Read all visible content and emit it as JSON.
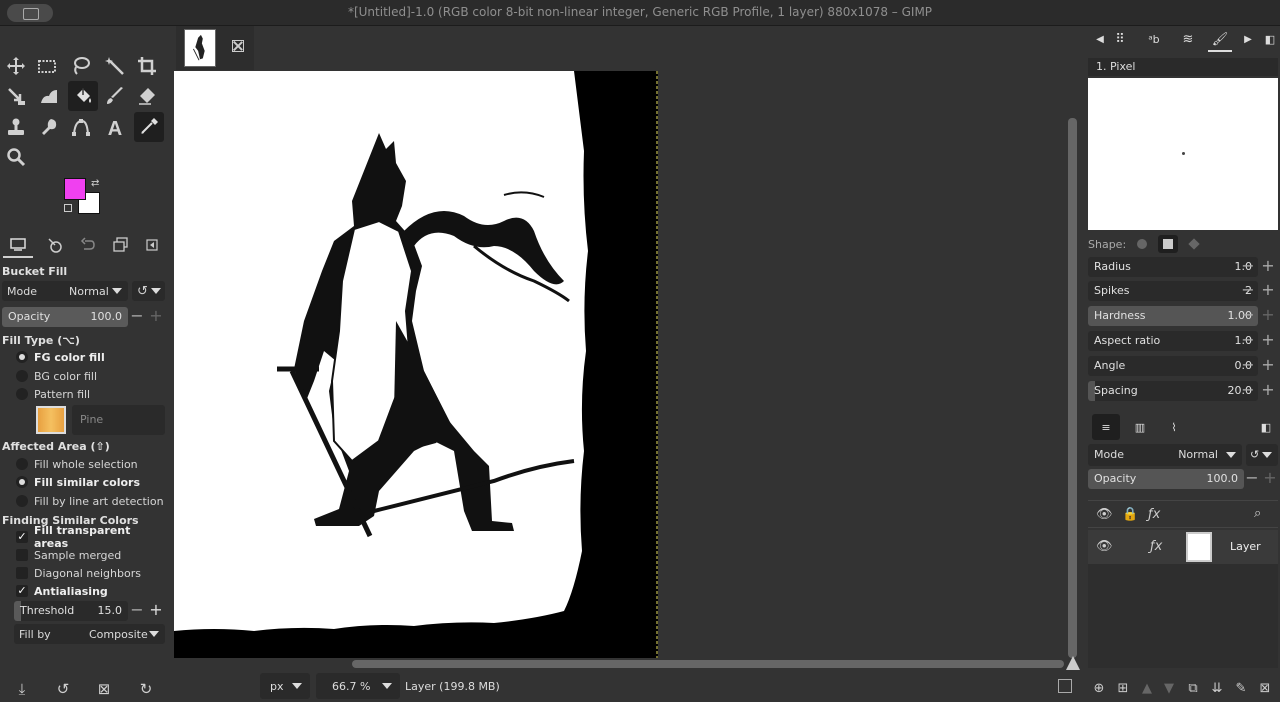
{
  "window": {
    "title": "*[Untitled]-1.0 (RGB color 8-bit non-linear integer, Generic RGB Profile, 1 layer) 880x1078 – GIMP"
  },
  "colors": {
    "foreground": "#f040f0",
    "background": "#ffffff",
    "canvas_bg": "#333333"
  },
  "toolbox": {
    "tools": [
      "move-tool",
      "rect-select-tool",
      "free-select-tool",
      "fuzzy-select-tool",
      "crop-tool",
      "unified-transform-tool",
      "warp-tool",
      "bucket-fill-tool",
      "paintbrush-tool",
      "eraser-tool",
      "clone-tool",
      "smudge-tool",
      "paths-tool",
      "text-tool",
      "color-picker-tool",
      "zoom-tool"
    ],
    "active_tool": "bucket-fill-tool"
  },
  "tool_options": {
    "title": "Bucket Fill",
    "mode_label": "Mode",
    "mode_value": "Normal",
    "opacity_label": "Opacity",
    "opacity_value": "100.0",
    "fill_type_label": "Fill Type  (⌥)",
    "fill_types": [
      "FG color fill",
      "BG color fill",
      "Pattern fill"
    ],
    "fill_type_selected": 0,
    "pattern_name": "Pine",
    "affected_area_label": "Affected Area  (⇧)",
    "affected_areas": [
      "Fill whole selection",
      "Fill similar colors",
      "Fill by line art detection"
    ],
    "affected_area_selected": 1,
    "finding_label": "Finding Similar Colors",
    "checks": [
      {
        "label": "Fill transparent areas",
        "checked": true
      },
      {
        "label": "Sample merged",
        "checked": false
      },
      {
        "label": "Diagonal neighbors",
        "checked": false
      },
      {
        "label": "Antialiasing",
        "checked": true
      }
    ],
    "threshold_label": "Threshold",
    "threshold_value": "15.0",
    "fill_by_label": "Fill by",
    "fill_by_value": "Composite"
  },
  "statusbar": {
    "units": "px",
    "zoom": "66.7 %",
    "message": "Layer (199.8 MB)"
  },
  "brushes": {
    "selected_brush": "1. Pixel",
    "shape_label": "Shape:",
    "params": [
      {
        "label": "Radius",
        "value": "1.0",
        "fraction": 0.0
      },
      {
        "label": "Spikes",
        "value": "2",
        "fraction": 0.0
      },
      {
        "label": "Hardness",
        "value": "1.00",
        "fraction": 1.0
      },
      {
        "label": "Aspect ratio",
        "value": "1.0",
        "fraction": 0.0
      },
      {
        "label": "Angle",
        "value": "0.0",
        "fraction": 0.0
      },
      {
        "label": "Spacing",
        "value": "20.0",
        "fraction": 0.04
      }
    ]
  },
  "layers": {
    "mode_label": "Mode",
    "mode_value": "Normal",
    "opacity_label": "Opacity",
    "opacity_value": "100.0",
    "items": [
      {
        "name": "Layer",
        "visible": true
      }
    ]
  }
}
